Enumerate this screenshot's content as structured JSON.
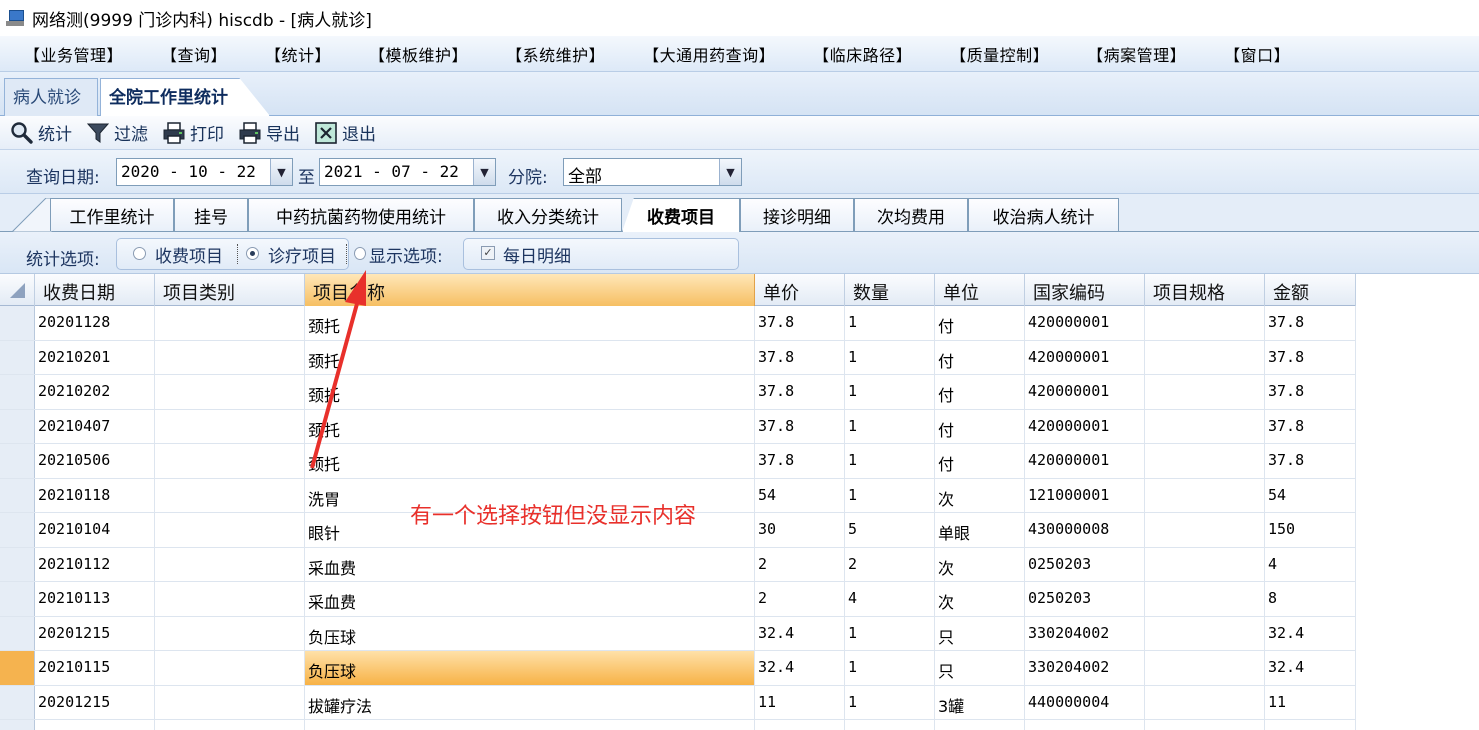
{
  "window": {
    "title": "网络测(9999 门诊内科)  hiscdb - [病人就诊]"
  },
  "menu": [
    "【业务管理】",
    "【查询】",
    "【统计】",
    "【模板维护】",
    "【系统维护】",
    "【大通用药查询】",
    "【临床路径】",
    "【质量控制】",
    "【病案管理】",
    "【窗口】"
  ],
  "module_tabs": [
    "病人就诊",
    "全院工作里统计"
  ],
  "toolbar": {
    "stat": "统计",
    "filter": "过滤",
    "print": "打印",
    "export": "导出",
    "exit": "退出"
  },
  "query": {
    "date_label": "查询日期:",
    "start_date": "2020 - 10 - 22",
    "to_label": "至",
    "end_date": "2021 - 07 - 22",
    "branch_label": "分院:",
    "branch_value": "全部"
  },
  "sub_tabs": [
    "工作里统计",
    "挂号",
    "中药抗菌药物使用统计",
    "收入分类统计",
    "收费项目",
    "接诊明细",
    "次均费用",
    "收治病人统计"
  ],
  "options": {
    "label": "统计选项:",
    "radio_fee": "收费项目",
    "radio_treat": "诊疗项目",
    "display_label": "显示选项:",
    "daily_detail": "每日明细",
    "daily_checked": true,
    "selected_radio": "诊疗项目"
  },
  "grid": {
    "headers": [
      "收费日期",
      "项目类别",
      "项目名称",
      "单价",
      "数量",
      "单位",
      "国家编码",
      "项目规格",
      "金额"
    ],
    "sorted_column": "项目名称",
    "selected_row_index": 10,
    "rows": [
      [
        "20201128",
        "",
        "颈托",
        "37.8",
        "1",
        "付",
        "420000001",
        "",
        "37.8"
      ],
      [
        "20210201",
        "",
        "颈托",
        "37.8",
        "1",
        "付",
        "420000001",
        "",
        "37.8"
      ],
      [
        "20210202",
        "",
        "颈托",
        "37.8",
        "1",
        "付",
        "420000001",
        "",
        "37.8"
      ],
      [
        "20210407",
        "",
        "颈托",
        "37.8",
        "1",
        "付",
        "420000001",
        "",
        "37.8"
      ],
      [
        "20210506",
        "",
        "颈托",
        "37.8",
        "1",
        "付",
        "420000001",
        "",
        "37.8"
      ],
      [
        "20210118",
        "",
        "洗胃",
        "54",
        "1",
        "次",
        "121000001",
        "",
        "54"
      ],
      [
        "20210104",
        "",
        "眼针",
        "30",
        "5",
        "单眼",
        "430000008",
        "",
        "150"
      ],
      [
        "20210112",
        "",
        "采血费",
        "2",
        "2",
        "次",
        "0250203",
        "",
        "4"
      ],
      [
        "20210113",
        "",
        "采血费",
        "2",
        "4",
        "次",
        "0250203",
        "",
        "8"
      ],
      [
        "20201215",
        "",
        "负压球",
        "32.4",
        "1",
        "只",
        "330204002",
        "",
        "32.4"
      ],
      [
        "20210115",
        "",
        "负压球",
        "32.4",
        "1",
        "只",
        "330204002",
        "",
        "32.4"
      ],
      [
        "20201215",
        "",
        "拔罐疗法",
        "11",
        "1",
        "3罐",
        "440000004",
        "",
        "11"
      ]
    ]
  },
  "annotation": {
    "text": "有一个选择按钮但没显示内容",
    "color": "#e8302b"
  }
}
